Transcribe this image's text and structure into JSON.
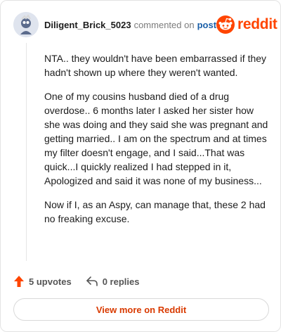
{
  "header": {
    "username": "Diligent_Brick_5023",
    "commented_text": "commented on",
    "post_link": "post",
    "brand_name": "reddit"
  },
  "comment": {
    "paragraphs": [
      "NTA.. they wouldn't have been embarrassed if they hadn't shown up where they weren't wanted.",
      "One of my cousins husband died of a drug overdose.. 6 months later I asked her sister how she was doing and they said she was pregnant and getting married.. I am on the spectrum and at times my filter doesn't engage, and I said...That was quick...I quickly realized I had stepped in it, Apologized and said it was none of my business...",
      "Now if I, as an Aspy, can manage that, these 2 had no freaking excuse."
    ]
  },
  "actions": {
    "upvotes_label": "5 upvotes",
    "replies_label": "0 replies"
  },
  "footer": {
    "view_more_label": "View more on Reddit"
  },
  "colors": {
    "brand": "#ff4500",
    "link": "#1a5fa8",
    "view_more_text": "#d93a00"
  },
  "icons": {
    "avatar": "avatar-icon",
    "logo": "reddit-alien-icon",
    "upvote": "upvote-arrow-icon",
    "reply": "reply-arrow-icon"
  }
}
